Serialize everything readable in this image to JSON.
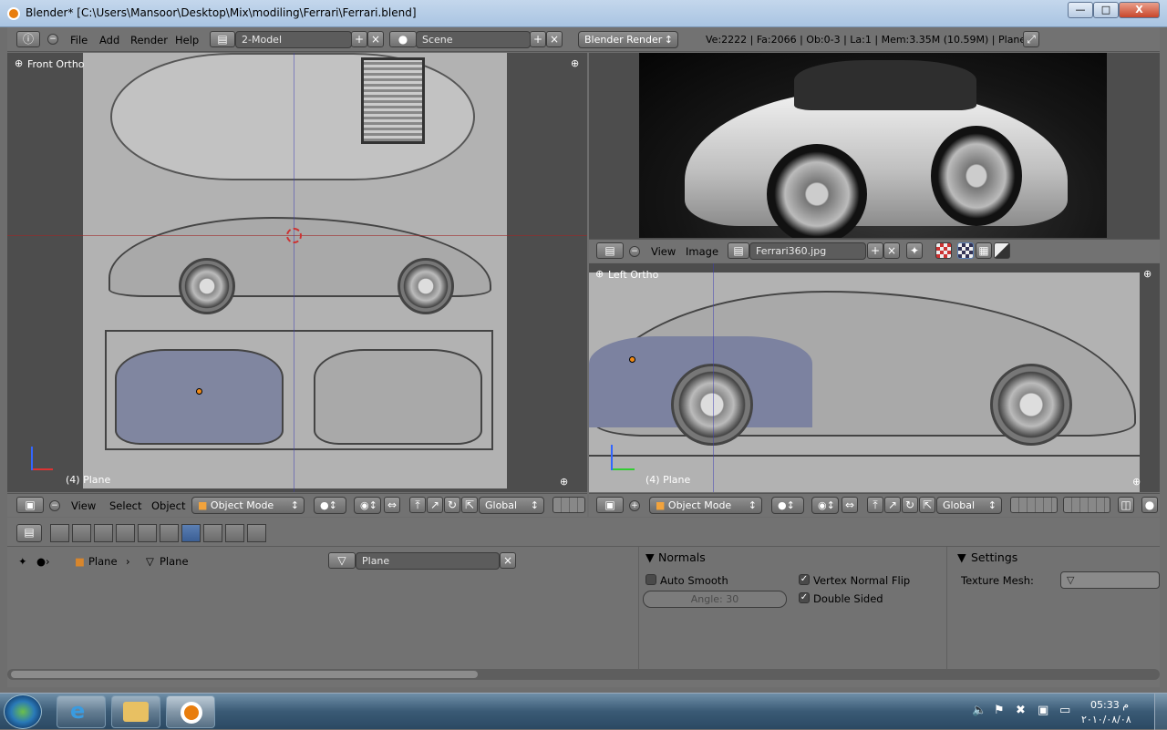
{
  "window": {
    "title": "Blender* [C:\\Users\\Mansoor\\Desktop\\Mix\\modiling\\Ferrari\\Ferrari.blend]",
    "controls": [
      "—",
      "□",
      "X"
    ]
  },
  "topbar": {
    "menus": [
      "File",
      "Add",
      "Render",
      "Help"
    ],
    "screen_layout": "2-Model",
    "scene": "Scene",
    "render_engine": "Blender Render",
    "stats": "Ve:2222 | Fa:2066 | Ob:0-3 | La:1 | Mem:3.35M (10.59M) | Plane"
  },
  "viewport_front": {
    "label": "Front Ortho",
    "object_label": "(4) Plane",
    "header": {
      "menus": [
        "View",
        "Select",
        "Object"
      ],
      "mode": "Object Mode",
      "orientation": "Global"
    }
  },
  "image_editor": {
    "menus": [
      "View",
      "Image"
    ],
    "image_name": "Ferrari360.jpg"
  },
  "viewport_left": {
    "label": "Left Ortho",
    "object_label": "(4) Plane",
    "header": {
      "mode": "Object Mode",
      "orientation": "Global"
    }
  },
  "properties": {
    "breadcrumb": [
      "Plane",
      "Plane"
    ],
    "mesh_name": "Plane",
    "normals": {
      "title": "Normals",
      "auto_smooth": "Auto Smooth",
      "angle": "Angle: 30",
      "vertex_normal_flip": "Vertex Normal Flip",
      "double_sided": "Double Sided"
    },
    "settings": {
      "title": "Settings",
      "texture_mesh": "Texture Mesh:"
    }
  },
  "taskbar": {
    "time": "05:33 م",
    "date": "٢٠١٠/٠٨/٠٨"
  },
  "colors": {
    "blender_bg": "#727272",
    "viewport_bg": "#4d4d4d",
    "accent_blue": "#5b7fb3",
    "title_bar": "#b9cde5"
  }
}
